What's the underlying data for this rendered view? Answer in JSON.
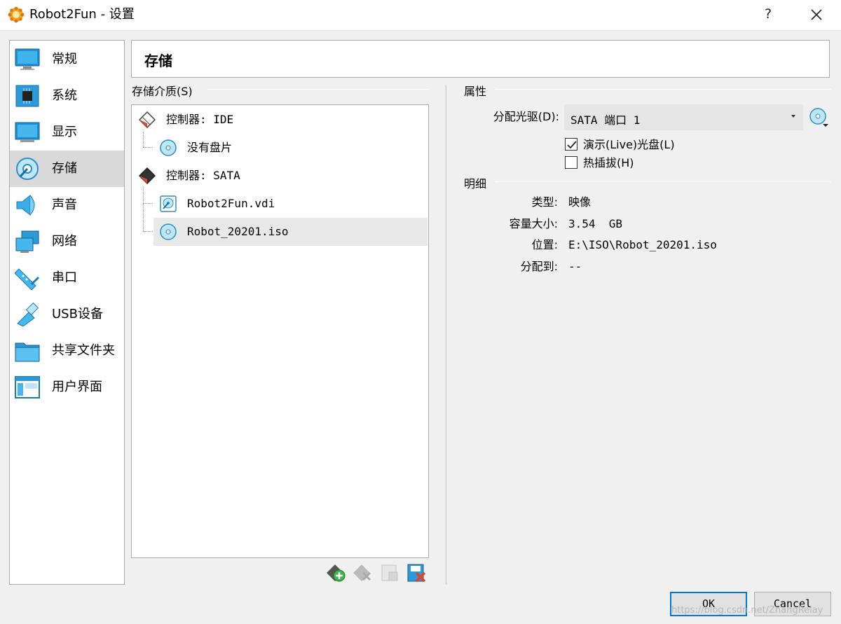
{
  "window": {
    "title": "Robot2Fun - 设置",
    "help_label": "?"
  },
  "sidebar": {
    "items": [
      {
        "label": "常规",
        "icon": "general-icon"
      },
      {
        "label": "系统",
        "icon": "system-icon"
      },
      {
        "label": "显示",
        "icon": "display-icon"
      },
      {
        "label": "存储",
        "icon": "storage-icon",
        "selected": true
      },
      {
        "label": "声音",
        "icon": "audio-icon"
      },
      {
        "label": "网络",
        "icon": "network-icon"
      },
      {
        "label": "串口",
        "icon": "serial-port-icon"
      },
      {
        "label": "USB设备",
        "icon": "usb-icon"
      },
      {
        "label": "共享文件夹",
        "icon": "shared-folder-icon"
      },
      {
        "label": "用户界面",
        "icon": "user-interface-icon"
      }
    ]
  },
  "header": {
    "title": "存储"
  },
  "storage": {
    "group_title": "存储介质(S)",
    "tree": [
      {
        "label": "控制器: IDE",
        "type": "controller"
      },
      {
        "label": "没有盘片",
        "type": "optical"
      },
      {
        "label": "控制器: SATA",
        "type": "controller"
      },
      {
        "label": "Robot2Fun.vdi",
        "type": "harddisk"
      },
      {
        "label": "Robot_20201.iso",
        "type": "optical",
        "selected": true
      }
    ]
  },
  "attributes": {
    "group_title": "属性",
    "drive_label": "分配光驱(D):",
    "drive_value": "SATA 端口 1",
    "live_cd_label": "演示(Live)光盘(L)",
    "live_cd_checked": true,
    "hotplug_label": "热插拔(H)",
    "hotplug_checked": false
  },
  "details": {
    "group_title": "明细",
    "rows": [
      {
        "label": "类型:",
        "value": "映像"
      },
      {
        "label": "容量大小:",
        "value": "3.54  GB"
      },
      {
        "label": "位置:",
        "value": "E:\\ISO\\Robot_20201.iso"
      },
      {
        "label": "分配到:",
        "value": "--"
      }
    ]
  },
  "buttons": {
    "ok": "OK",
    "cancel": "Cancel"
  },
  "watermark": "https://blog.csdn.net/ZhangRelay",
  "colors": {
    "accent": "#0078d7",
    "selected_bg": "#d9d9d9",
    "icon_blue": "#29a3dc"
  }
}
